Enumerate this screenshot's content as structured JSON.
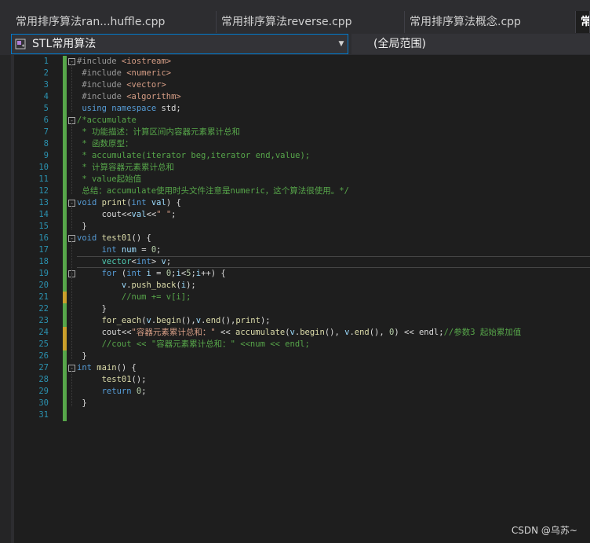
{
  "tabs": [
    {
      "label": "常用排序算法ran...huffle.cpp",
      "active": false
    },
    {
      "label": "常用排序算法reverse.cpp",
      "active": false
    },
    {
      "label": "常用排序算法概念.cpp",
      "active": false
    },
    {
      "label": "常",
      "active": true
    }
  ],
  "navbar": {
    "scope": "STL常用算法",
    "member": "(全局范围)"
  },
  "editor": {
    "current_line": 18,
    "lines": [
      {
        "n": 1,
        "fold": "-",
        "mark": "added",
        "tokens": [
          [
            "pp",
            "#include "
          ],
          [
            "inc",
            "<iostream>"
          ]
        ]
      },
      {
        "n": 2,
        "mark": "added",
        "tokens": [
          [
            "pp",
            " #include "
          ],
          [
            "inc",
            "<numeric>"
          ]
        ]
      },
      {
        "n": 3,
        "mark": "added",
        "tokens": [
          [
            "pp",
            " #include "
          ],
          [
            "inc",
            "<vector>"
          ]
        ]
      },
      {
        "n": 4,
        "mark": "added",
        "tokens": [
          [
            "pp",
            " #include "
          ],
          [
            "inc",
            "<algorithm>"
          ]
        ]
      },
      {
        "n": 5,
        "mark": "added",
        "tokens": [
          [
            "kw",
            " using namespace "
          ],
          [
            "plain",
            "std;"
          ]
        ]
      },
      {
        "n": 6,
        "fold": "-",
        "mark": "added",
        "tokens": [
          [
            "cmt",
            "/*accumulate"
          ]
        ]
      },
      {
        "n": 7,
        "mark": "added",
        "tokens": [
          [
            "cmt",
            " * 功能描述：计算区间内容器元素累计总和"
          ]
        ]
      },
      {
        "n": 8,
        "mark": "added",
        "tokens": [
          [
            "cmt",
            " * 函数原型："
          ]
        ]
      },
      {
        "n": 9,
        "mark": "added",
        "tokens": [
          [
            "cmt",
            " * accumulate(iterator beg,iterator end,value);"
          ]
        ]
      },
      {
        "n": 10,
        "mark": "added",
        "tokens": [
          [
            "cmt",
            " * 计算容器元素累计总和"
          ]
        ]
      },
      {
        "n": 11,
        "mark": "added",
        "tokens": [
          [
            "cmt",
            " * value起始值"
          ]
        ]
      },
      {
        "n": 12,
        "mark": "added",
        "tokens": [
          [
            "cmt",
            " 总结：accumulate使用时头文件注意是numeric，这个算法很使用。*/"
          ]
        ]
      },
      {
        "n": 13,
        "fold": "-",
        "mark": "added",
        "tokens": [
          [
            "kw",
            "void "
          ],
          [
            "fn",
            "print"
          ],
          [
            "plain",
            "("
          ],
          [
            "kw",
            "int "
          ],
          [
            "var",
            "val"
          ],
          [
            "plain",
            ") {"
          ]
        ]
      },
      {
        "n": 14,
        "mark": "added",
        "tokens": [
          [
            "plain",
            "     cout<<"
          ],
          [
            "var",
            "val"
          ],
          [
            "plain",
            "<<"
          ],
          [
            "str",
            "\" \""
          ],
          [
            "plain",
            ";"
          ]
        ]
      },
      {
        "n": 15,
        "mark": "added",
        "tokens": [
          [
            "plain",
            " }"
          ]
        ]
      },
      {
        "n": 16,
        "fold": "-",
        "mark": "added",
        "tokens": [
          [
            "kw",
            "void "
          ],
          [
            "fn",
            "test01"
          ],
          [
            "plain",
            "() {"
          ]
        ]
      },
      {
        "n": 17,
        "mark": "added",
        "tokens": [
          [
            "kw",
            "     int "
          ],
          [
            "var",
            "num"
          ],
          [
            "plain",
            " = "
          ],
          [
            "num",
            "0"
          ],
          [
            "plain",
            ";"
          ]
        ]
      },
      {
        "n": 18,
        "mark": "added",
        "tokens": [
          [
            "type",
            "     vector"
          ],
          [
            "plain",
            "<"
          ],
          [
            "kw",
            "int"
          ],
          [
            "plain",
            "> "
          ],
          [
            "var",
            "v"
          ],
          [
            "plain",
            ";"
          ]
        ]
      },
      {
        "n": 19,
        "fold": "-",
        "mark": "added",
        "tokens": [
          [
            "kw",
            "     for "
          ],
          [
            "plain",
            "("
          ],
          [
            "kw",
            "int "
          ],
          [
            "var",
            "i"
          ],
          [
            "plain",
            " = "
          ],
          [
            "num",
            "0"
          ],
          [
            "plain",
            ";"
          ],
          [
            "var",
            "i"
          ],
          [
            "plain",
            "<"
          ],
          [
            "num",
            "5"
          ],
          [
            "plain",
            ";"
          ],
          [
            "var",
            "i"
          ],
          [
            "plain",
            "++) {"
          ]
        ]
      },
      {
        "n": 20,
        "mark": "added",
        "tokens": [
          [
            "var",
            "         v"
          ],
          [
            "plain",
            "."
          ],
          [
            "fn",
            "push_back"
          ],
          [
            "plain",
            "("
          ],
          [
            "var",
            "i"
          ],
          [
            "plain",
            ");"
          ]
        ]
      },
      {
        "n": 21,
        "mark": "modified",
        "tokens": [
          [
            "cmt",
            "         //num += v[i];"
          ]
        ]
      },
      {
        "n": 22,
        "mark": "added",
        "tokens": [
          [
            "plain",
            "     }"
          ]
        ]
      },
      {
        "n": 23,
        "mark": "added",
        "tokens": [
          [
            "fn",
            "     for_each"
          ],
          [
            "plain",
            "("
          ],
          [
            "var",
            "v"
          ],
          [
            "plain",
            "."
          ],
          [
            "fn",
            "begin"
          ],
          [
            "plain",
            "(),"
          ],
          [
            "var",
            "v"
          ],
          [
            "plain",
            "."
          ],
          [
            "fn",
            "end"
          ],
          [
            "plain",
            "(),"
          ],
          [
            "fn",
            "print"
          ],
          [
            "plain",
            ");"
          ]
        ]
      },
      {
        "n": 24,
        "mark": "modified",
        "tokens": [
          [
            "plain",
            "     cout<<"
          ],
          [
            "str",
            "\"容器元素累计总和：\""
          ],
          [
            "plain",
            " << "
          ],
          [
            "fn",
            "accumulate"
          ],
          [
            "plain",
            "("
          ],
          [
            "var",
            "v"
          ],
          [
            "plain",
            "."
          ],
          [
            "fn",
            "begin"
          ],
          [
            "plain",
            "(), "
          ],
          [
            "var",
            "v"
          ],
          [
            "plain",
            "."
          ],
          [
            "fn",
            "end"
          ],
          [
            "plain",
            "(), "
          ],
          [
            "num",
            "0"
          ],
          [
            "plain",
            ") << endl;"
          ],
          [
            "cmt",
            "//参数3 起始累加值"
          ]
        ]
      },
      {
        "n": 25,
        "mark": "modified",
        "tokens": [
          [
            "cmt",
            "     //cout << \"容器元素累计总和：\" <<num << endl;"
          ]
        ]
      },
      {
        "n": 26,
        "mark": "added",
        "tokens": [
          [
            "plain",
            " }"
          ]
        ]
      },
      {
        "n": 27,
        "fold": "-",
        "mark": "added",
        "tokens": [
          [
            "kw",
            "int "
          ],
          [
            "fn",
            "main"
          ],
          [
            "plain",
            "() {"
          ]
        ]
      },
      {
        "n": 28,
        "mark": "added",
        "tokens": [
          [
            "fn",
            "     test01"
          ],
          [
            "plain",
            "();"
          ]
        ]
      },
      {
        "n": 29,
        "mark": "added",
        "tokens": [
          [
            "kw",
            "     return "
          ],
          [
            "num",
            "0"
          ],
          [
            "plain",
            ";"
          ]
        ]
      },
      {
        "n": 30,
        "mark": "added",
        "tokens": [
          [
            "plain",
            " }"
          ]
        ]
      },
      {
        "n": 31,
        "mark": "added",
        "tokens": []
      }
    ]
  },
  "watermark": "CSDN @乌苏~",
  "colors": {
    "keyword": "#569cd6",
    "comment": "#57a64a",
    "string": "#d69d85",
    "line_number": "#2b91af",
    "change_added": "#57a64a",
    "change_modified": "#ca9f2b",
    "accent": "#007acc"
  },
  "icons": {
    "scope": "class-scope-icon",
    "dropdown": "chevron-down-icon"
  }
}
